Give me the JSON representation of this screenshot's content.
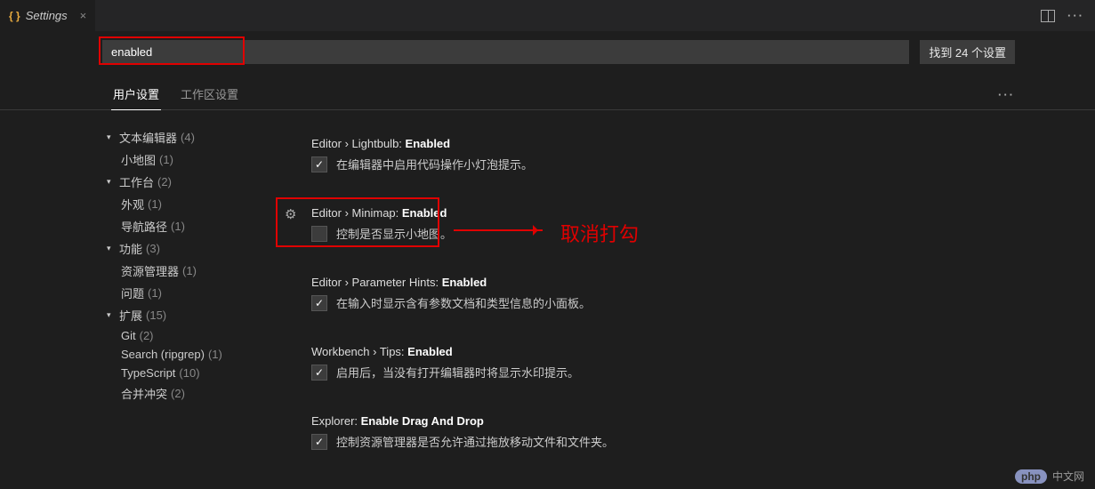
{
  "tab": {
    "title": "Settings",
    "close": "×"
  },
  "search": {
    "value": "enabled",
    "result": "找到 24 个设置"
  },
  "settings_tabs": {
    "user": "用户设置",
    "workspace": "工作区设置"
  },
  "tree": {
    "items": [
      {
        "label": "文本编辑器",
        "count": "(4)",
        "expandable": true,
        "children": [
          {
            "label": "小地图",
            "count": "(1)"
          }
        ]
      },
      {
        "label": "工作台",
        "count": "(2)",
        "expandable": true,
        "children": [
          {
            "label": "外观",
            "count": "(1)"
          },
          {
            "label": "导航路径",
            "count": "(1)"
          }
        ]
      },
      {
        "label": "功能",
        "count": "(3)",
        "expandable": true,
        "children": [
          {
            "label": "资源管理器",
            "count": "(1)"
          },
          {
            "label": "问题",
            "count": "(1)"
          }
        ]
      },
      {
        "label": "扩展",
        "count": "(15)",
        "expandable": true,
        "children": [
          {
            "label": "Git",
            "count": "(2)"
          },
          {
            "label": "Search (ripgrep)",
            "count": "(1)"
          },
          {
            "label": "TypeScript",
            "count": "(10)"
          },
          {
            "label": "合并冲突",
            "count": "(2)"
          }
        ]
      }
    ]
  },
  "settings": [
    {
      "scope1": "Editor",
      "sep1": " › ",
      "scope2": "Lightbulb: ",
      "key": "Enabled",
      "checked": true,
      "desc": "在编辑器中启用代码操作小灯泡提示。"
    },
    {
      "scope1": "Editor",
      "sep1": " › ",
      "scope2": "Minimap: ",
      "key": "Enabled",
      "checked": false,
      "desc": "控制是否显示小地图。",
      "gear": true,
      "highlighted": true,
      "annotation": "取消打勾"
    },
    {
      "scope1": "Editor",
      "sep1": " › ",
      "scope2": "Parameter Hints: ",
      "key": "Enabled",
      "checked": true,
      "desc": "在输入时显示含有参数文档和类型信息的小面板。"
    },
    {
      "scope1": "Workbench",
      "sep1": " › ",
      "scope2": "Tips: ",
      "key": "Enabled",
      "checked": true,
      "desc": "启用后，当没有打开编辑器时将显示水印提示。"
    },
    {
      "scope1": "Explorer: ",
      "sep1": "",
      "scope2": "",
      "key": "Enable Drag And Drop",
      "checked": true,
      "desc": "控制资源管理器是否允许通过拖放移动文件和文件夹。"
    }
  ],
  "watermark": {
    "badge": "php",
    "text": "中文网"
  }
}
